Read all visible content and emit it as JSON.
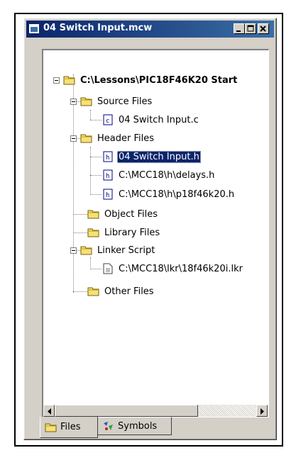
{
  "window": {
    "title": "04 Switch Input.mcw"
  },
  "tree": {
    "root": "C:\\Lessons\\PIC18F46K20 Start",
    "groups": [
      {
        "label": "Source Files",
        "files": [
          "04 Switch Input.c"
        ]
      },
      {
        "label": "Header Files",
        "files": [
          "04 Switch Input.h",
          "C:\\MCC18\\h\\delays.h",
          "C:\\MCC18\\h\\p18f46k20.h"
        ]
      },
      {
        "label": "Object Files",
        "files": []
      },
      {
        "label": "Library Files",
        "files": []
      },
      {
        "label": "Linker Script",
        "files": [
          "C:\\MCC18\\lkr\\18f46k20i.lkr"
        ]
      },
      {
        "label": "Other Files",
        "files": []
      }
    ],
    "selected_file": "04 Switch Input.h"
  },
  "tabs": [
    {
      "label": "Files",
      "active": true,
      "icon": "folder-icon"
    },
    {
      "label": "Symbols",
      "active": false,
      "icon": "symbols-icon"
    }
  ]
}
